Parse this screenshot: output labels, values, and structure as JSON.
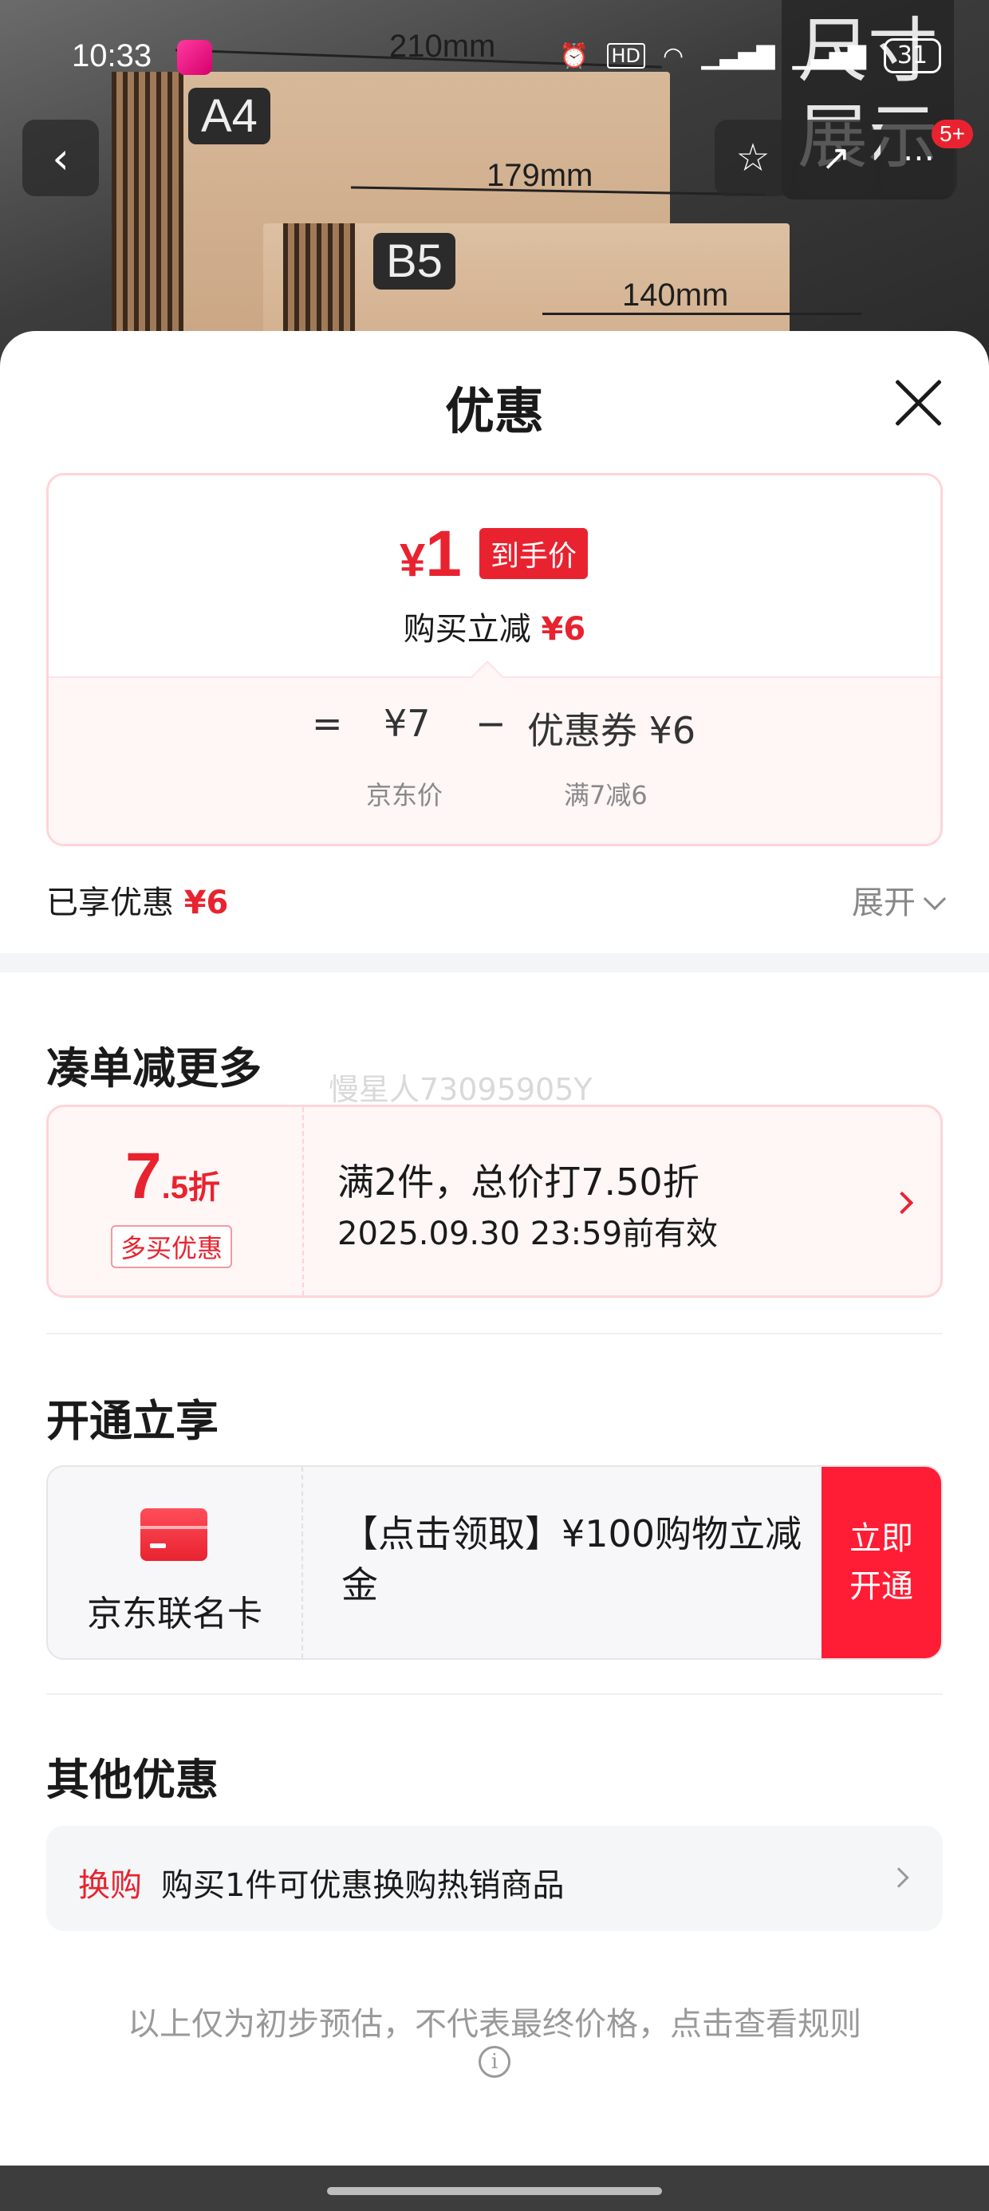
{
  "status_bar": {
    "time": "10:33",
    "icons": [
      "alarm-icon",
      "hd-icon",
      "wifi-icon",
      "5g-signal-icon",
      "5g-signal-icon"
    ],
    "battery": "31"
  },
  "background_photo": {
    "size_a4": "A4",
    "size_b5": "B5",
    "dim_210": "210mm",
    "dim_179": "179mm",
    "dim_140": "140mm",
    "overlay_text": "尺寸展示",
    "cart_badge": "5+"
  },
  "sheet": {
    "title": "优惠",
    "price_card": {
      "currency": "¥",
      "final_price": "1",
      "final_price_tag": "到手价",
      "instant_label": "购买立减",
      "instant_amount": "¥6",
      "eq": "=",
      "base_price": "¥7",
      "minus": "−",
      "coupon_label": "优惠券 ¥6",
      "base_caption": "京东价",
      "coupon_caption": "满7减6"
    },
    "enjoyed": {
      "label": "已享优惠",
      "amount": "¥6",
      "expand": "展开"
    },
    "bundle": {
      "title": "凑单减更多",
      "watermark": "慢星人73095905Y",
      "discount_int": "7",
      "discount_frac": ".5折",
      "discount_tag": "多买优惠",
      "main": "满2件，总价打7.50折",
      "validity": "2025.09.30 23:59前有效"
    },
    "membership": {
      "title": "开通立享",
      "card_name": "京东联名卡",
      "offer": "【点击领取】¥100购物立减金",
      "button": "立即开通"
    },
    "other": {
      "title": "其他优惠",
      "tag": "换购",
      "text": "购买1件可优惠换购热销商品"
    },
    "disclaimer": "以上仅为初步预估，不代表最终价格，点击查看规则"
  },
  "colors": {
    "accent_red": "#e8232f",
    "button_red": "#ff1d35",
    "card_pink_bg": "#fff6f6"
  }
}
